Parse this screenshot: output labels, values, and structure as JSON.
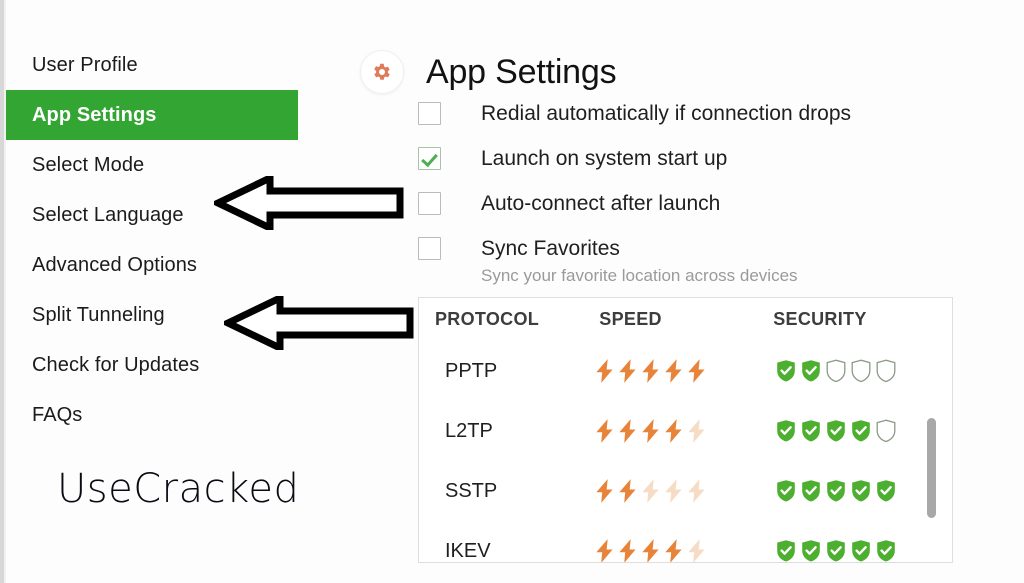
{
  "window": {
    "watermark": "UseCracked"
  },
  "sidebar": {
    "items": [
      {
        "label": "User Profile",
        "active": false
      },
      {
        "label": "App Settings",
        "active": true
      },
      {
        "label": "Select Mode",
        "active": false
      },
      {
        "label": "Select Language",
        "active": false
      },
      {
        "label": "Advanced Options",
        "active": false
      },
      {
        "label": "Split Tunneling",
        "active": false
      },
      {
        "label": "Check for Updates",
        "active": false
      },
      {
        "label": "FAQs",
        "active": false
      }
    ]
  },
  "header": {
    "icon": "gear-icon",
    "title": "App Settings",
    "icon_color": "#e07b5a",
    "accent_color": "#33a532"
  },
  "options": [
    {
      "label": "Redial automatically if connection drops",
      "checked": false,
      "sub": ""
    },
    {
      "label": "Launch on system start up",
      "checked": true,
      "sub": ""
    },
    {
      "label": "Auto-connect after launch",
      "checked": false,
      "sub": ""
    },
    {
      "label": "Sync Favorites",
      "checked": false,
      "sub": "Sync your favorite location across devices"
    }
  ],
  "table": {
    "columns": [
      "PROTOCOL",
      "SPEED",
      "SECURITY"
    ],
    "max_speed": 5,
    "max_security": 5,
    "speed_color": "#e8833a",
    "speed_color_muted": "#f6dcc4",
    "security_color": "#4caf2f",
    "security_color_muted": "#ffffff",
    "rows": [
      {
        "protocol": "PPTP",
        "speed": 5,
        "security": 2
      },
      {
        "protocol": "L2TP",
        "speed": 4,
        "security": 4
      },
      {
        "protocol": "SSTP",
        "speed": 2,
        "security": 5
      },
      {
        "protocol": "IKEV",
        "speed": 4,
        "security": 5
      }
    ]
  },
  "annotations": [
    {
      "name": "arrow-select-language",
      "direction": "left"
    },
    {
      "name": "arrow-split-tunneling",
      "direction": "left"
    }
  ]
}
